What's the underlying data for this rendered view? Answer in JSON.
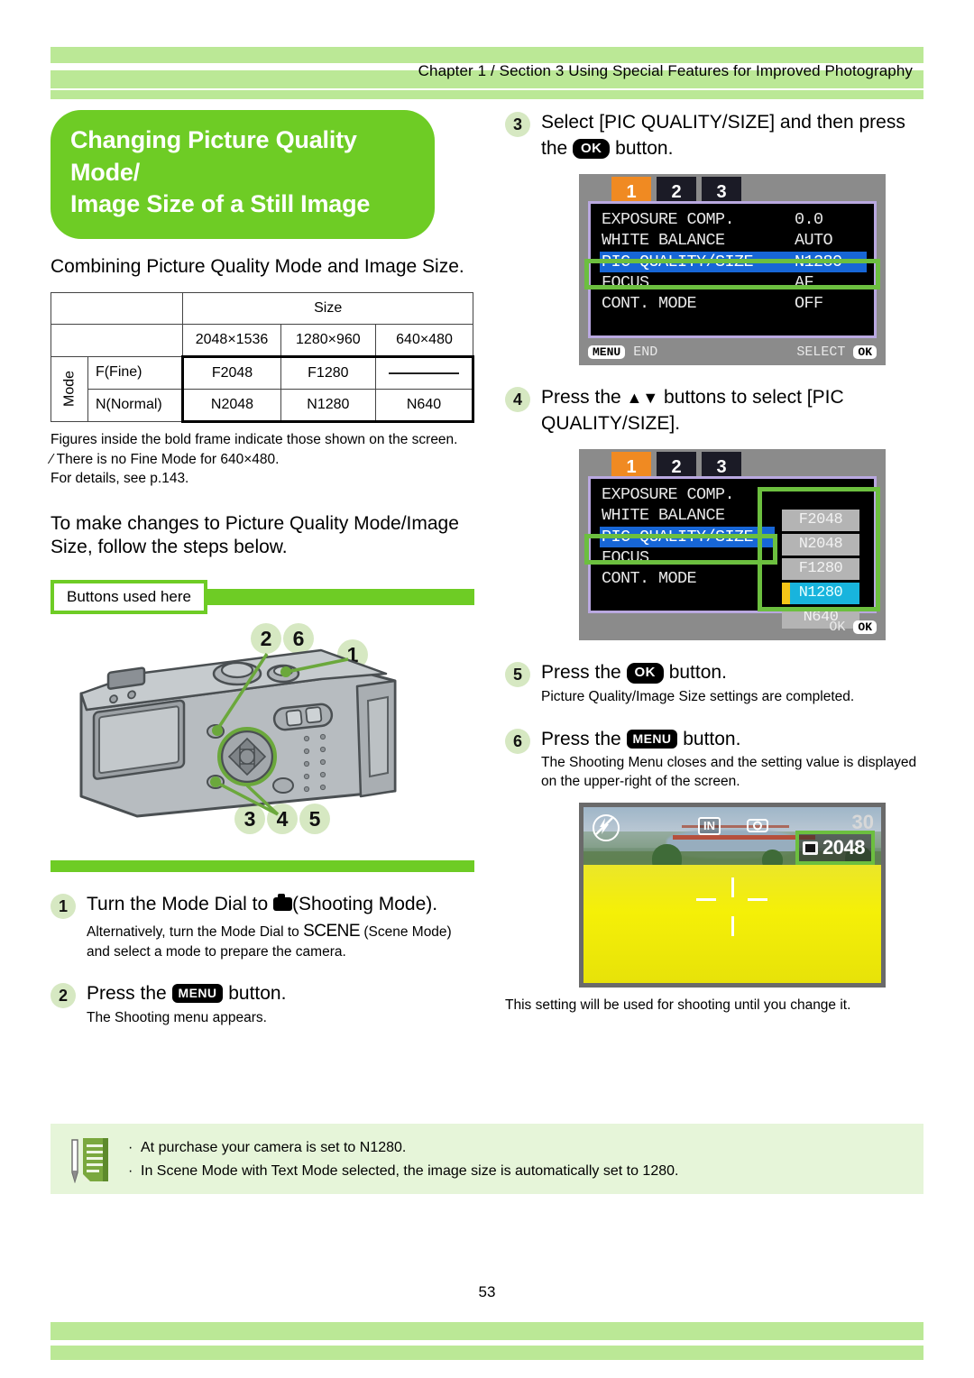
{
  "header": {
    "breadcrumb": "Chapter 1 / Section 3  Using Special Features for Improved Photography"
  },
  "title": {
    "line1": "Changing Picture Quality Mode/",
    "line2": "Image Size of a Still Image"
  },
  "intro": {
    "text": "Combining Picture Quality Mode and Image Size."
  },
  "table": {
    "size_header": "Size",
    "mode_header": "Mode",
    "columns": [
      "2048×1536",
      "1280×960",
      "640×480"
    ],
    "rows": [
      {
        "label": "F(Fine)",
        "values": [
          "F2048",
          "F1280",
          "—"
        ]
      },
      {
        "label": "N(Normal)",
        "values": [
          "N2048",
          "N1280",
          "N640"
        ]
      }
    ]
  },
  "table_notes": {
    "line1": "Figures inside the bold frame indicate those shown on the screen.",
    "line2": "⁄ There is no Fine Mode for 640×480.",
    "line3": "For details, see p.143."
  },
  "lead_in": {
    "text": "To make changes to Picture Quality Mode/Image Size, follow the steps below."
  },
  "buttons_banner": {
    "label": "Buttons used here"
  },
  "camera_figure": {
    "callouts_top": [
      "2",
      "6",
      "1"
    ],
    "callouts_bottom": [
      "3",
      "4",
      "5"
    ]
  },
  "steps": [
    {
      "num": "1",
      "main_pre": "Turn the Mode Dial to ",
      "main_icon": "camera-icon",
      "main_post": "(Shooting Mode).",
      "sub_pre": "Alternatively, turn the Mode Dial to ",
      "sub_key": "SCENE",
      "sub_post": "(Scene Mode) and select a mode to prepare the camera."
    },
    {
      "num": "2",
      "main_pre": "Press the ",
      "main_key": "MENU",
      "main_post": " button.",
      "sub": "The Shooting menu appears."
    },
    {
      "num": "3",
      "main_pre": "Select  [PIC QUALITY/SIZE] and then press the ",
      "main_key": "OK",
      "main_post": " button."
    },
    {
      "num": "4",
      "main_pre": "Press the ",
      "main_arrows": "▲▼",
      "main_post": " buttons to select [PIC QUALITY/SIZE]."
    },
    {
      "num": "5",
      "main_pre": "Press the ",
      "main_key": "OK",
      "main_post": " button.",
      "sub": "Picture Quality/Image Size settings are completed."
    },
    {
      "num": "6",
      "main_pre": "Press the ",
      "main_key": "MENU",
      "main_post": " button.",
      "sub": "The Shooting Menu closes and the setting value is displayed on the upper-right of the screen."
    }
  ],
  "lcd_menu": {
    "tabs": [
      "1",
      "2",
      "3"
    ],
    "rows": [
      {
        "label": "EXPOSURE COMP.",
        "value": "0.0"
      },
      {
        "label": "WHITE BALANCE",
        "value": "AUTO"
      },
      {
        "label": "PIC QUALITY/SIZE",
        "value": "N1280"
      },
      {
        "label": "FOCUS",
        "value": "AF"
      },
      {
        "label": "CONT. MODE",
        "value": "OFF"
      }
    ],
    "footer_left_key": "MENU",
    "footer_left_text": "END",
    "footer_right_text": "SELECT",
    "footer_right_key": "OK"
  },
  "lcd_dropdown": {
    "tabs": [
      "1",
      "2",
      "3"
    ],
    "rows": [
      {
        "label": "EXPOSURE COMP.",
        "value": ""
      },
      {
        "label": "WHITE BALANCE",
        "value": ""
      },
      {
        "label": "PIC QUALITY/SIZE",
        "value": ""
      },
      {
        "label": "FOCUS",
        "value": ""
      },
      {
        "label": "CONT. MODE",
        "value": ""
      }
    ],
    "options": [
      "F2048",
      "N2048",
      "F1280",
      "N1280",
      "N640"
    ],
    "selected_option": "N1280",
    "footer_right_text": "OK",
    "footer_right_key": "OK"
  },
  "lcd_photo": {
    "flash_icon": "flash-off-icon",
    "memory_badge": "IN",
    "camera_badge": "camera-icon",
    "remaining": "30",
    "size_value": "2048",
    "size_icon": "fine-quality-icon"
  },
  "photo_caption": {
    "text": "This setting will be used for shooting until you change it."
  },
  "memo": {
    "icon": "memo-note-icon",
    "items": [
      "At purchase your camera is set to N1280.",
      "In Scene Mode with Text Mode selected, the image size is automatically set to 1280."
    ]
  },
  "footer": {
    "page_number": "53"
  },
  "colors": {
    "bar_green": "#bbe896",
    "accent_green": "#6ecc25",
    "highlight_green": "#6cbf3f",
    "num_badge": "#d6e8c2",
    "menu_select_blue": "#1766d6",
    "option_select_cyan": "#18b4dd",
    "tab_orange": "#f08a22",
    "memo_bg": "#e6f5d9"
  }
}
